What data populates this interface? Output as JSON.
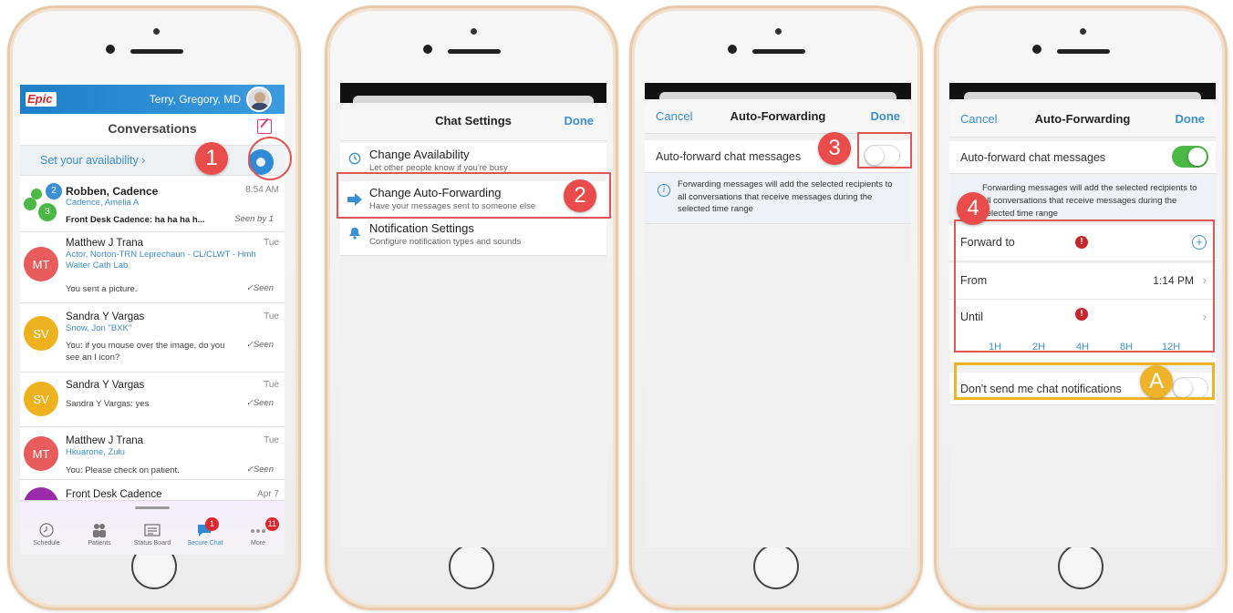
{
  "callouts": {
    "step1": "1",
    "step2": "2",
    "step3": "3",
    "step4": "4",
    "stepA": "A"
  },
  "screen1": {
    "logo": "Epic",
    "user_name": "Terry, Gregory, MD",
    "title": "Conversations",
    "availability_link": "Set your availability",
    "conversations": [
      {
        "name": "Robben, Cadence",
        "subtitle": "Cadence, Amelia A",
        "message": "Front Desk Cadence: ha ha ha h...",
        "time": "8:54 AM",
        "status": "Seen by 1",
        "avatar_badge": "2",
        "avatar_count": "3"
      },
      {
        "name": "Matthew J Trana",
        "subtitle": "Actor, Norton-TRN Leprechaun - CL/CLWT - Hmh Walter Cath Lab",
        "message": "You sent a picture.",
        "time": "Tue",
        "status": "Seen",
        "initials": "MT",
        "color": "#ea5b5b"
      },
      {
        "name": "Sandra Y Vargas",
        "subtitle": "Snow, Jon \"BXK\"",
        "message": "You: if you mouse over the image, do you see an I icon?",
        "time": "Tue",
        "status": "Seen",
        "initials": "SV",
        "color": "#efb21e"
      },
      {
        "name": "Sandra Y Vargas",
        "subtitle": "",
        "message": "Sandra Y Vargas: yes",
        "time": "Tue",
        "status": "Seen",
        "initials": "SV",
        "color": "#efb21e"
      },
      {
        "name": "Matthew J Trana",
        "subtitle": "Hkuarone, Zulu",
        "message": "You: Please check on patient.",
        "time": "Tue",
        "status": "Seen",
        "initials": "MT",
        "color": "#ea5b5b"
      },
      {
        "name": "Front Desk Cadence",
        "time": "Apr 7",
        "color": "#9b2aa8"
      }
    ],
    "tabs": [
      {
        "label": "Schedule",
        "icon": "clock-icon"
      },
      {
        "label": "Patients",
        "icon": "people-icon"
      },
      {
        "label": "Status Board",
        "icon": "board-icon"
      },
      {
        "label": "Secure Chat",
        "icon": "chat-icon",
        "badge": "1"
      },
      {
        "label": "More",
        "icon": "more-icon",
        "badge": "11"
      }
    ]
  },
  "screen2": {
    "title": "Chat Settings",
    "done": "Done",
    "items": [
      {
        "title": "Change Availability",
        "subtitle": "Let other people know if you're busy",
        "icon": "clock-icon"
      },
      {
        "title": "Change Auto-Forwarding",
        "subtitle": "Have your messages sent to someone else",
        "icon": "arrow-right-icon"
      },
      {
        "title": "Notification Settings",
        "subtitle": "Configure notification types and sounds",
        "icon": "bell-icon"
      }
    ]
  },
  "screen3": {
    "cancel": "Cancel",
    "title": "Auto-Forwarding",
    "done": "Done",
    "toggle_label": "Auto-forward chat messages",
    "toggle_on": false,
    "info": "Forwarding messages will add the selected recipients to all conversations that receive messages during the selected time range"
  },
  "screen4": {
    "cancel": "Cancel",
    "title": "Auto-Forwarding",
    "done": "Done",
    "toggle_label": "Auto-forward chat messages",
    "toggle_on": true,
    "info": "Forwarding messages will add the selected recipients to all conversations that receive messages during the selected time range",
    "forward_to_label": "Forward to",
    "from_label": "From",
    "from_value": "1:14 PM",
    "until_label": "Until",
    "durations": [
      "1H",
      "2H",
      "4H",
      "8H",
      "12H"
    ],
    "notify_label": "Don't send me chat notifications",
    "notify_on": false
  },
  "colors": {
    "accent": "#3b8fd3",
    "callout_red": "#ea4b4b",
    "callout_gold": "#efb32a",
    "toggle_on": "#4cb846"
  }
}
